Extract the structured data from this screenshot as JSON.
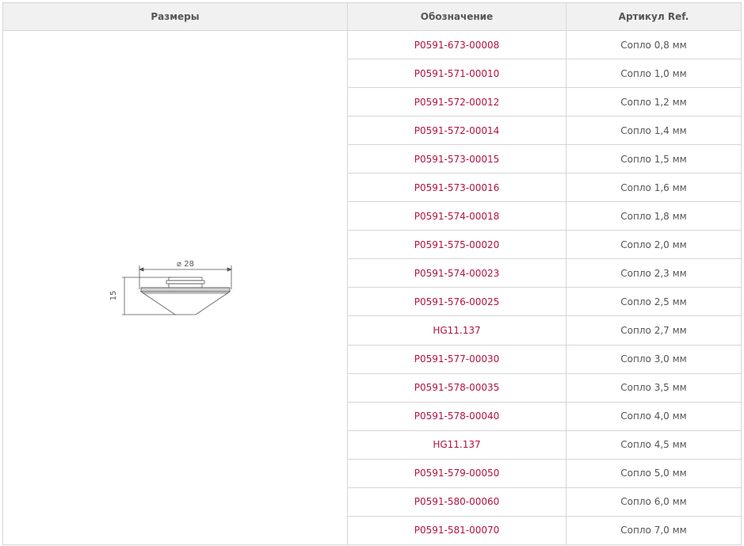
{
  "headers": {
    "sizes": "Размеры",
    "designation": "Обозначение",
    "article": "Артикул Ref."
  },
  "drawing": {
    "diameter_label": "⌀ 28",
    "height_label": "15"
  },
  "colors": {
    "link": "#b3123e",
    "header_bg": "#f1f1f1",
    "border": "#d6d6d6"
  },
  "rows": [
    {
      "code": "P0591-673-00008",
      "desc": "Сопло 0,8 мм"
    },
    {
      "code": "P0591-571-00010",
      "desc": "Сопло 1,0 мм"
    },
    {
      "code": "P0591-572-00012",
      "desc": "Сопло 1,2 мм"
    },
    {
      "code": "P0591-572-00014",
      "desc": "Сопло 1,4 мм"
    },
    {
      "code": "P0591-573-00015",
      "desc": "Сопло 1,5 мм"
    },
    {
      "code": "P0591-573-00016",
      "desc": "Сопло 1,6 мм"
    },
    {
      "code": "P0591-574-00018",
      "desc": "Сопло 1,8 мм"
    },
    {
      "code": "P0591-575-00020",
      "desc": "Сопло 2,0 мм"
    },
    {
      "code": "P0591-574-00023",
      "desc": "Сопло 2,3 мм"
    },
    {
      "code": "P0591-576-00025",
      "desc": "Сопло 2,5 мм"
    },
    {
      "code": "HG11.137",
      "desc": "Сопло 2,7 мм"
    },
    {
      "code": "P0591-577-00030",
      "desc": "Сопло 3,0 мм"
    },
    {
      "code": "P0591-578-00035",
      "desc": "Сопло 3,5 мм"
    },
    {
      "code": "P0591-578-00040",
      "desc": "Сопло 4,0 мм"
    },
    {
      "code": "HG11.137",
      "desc": "Сопло 4,5 мм"
    },
    {
      "code": "P0591-579-00050",
      "desc": "Сопло 5,0 мм"
    },
    {
      "code": "P0591-580-00060",
      "desc": "Сопло 6,0 мм"
    },
    {
      "code": "P0591-581-00070",
      "desc": "Сопло 7,0 мм"
    }
  ]
}
